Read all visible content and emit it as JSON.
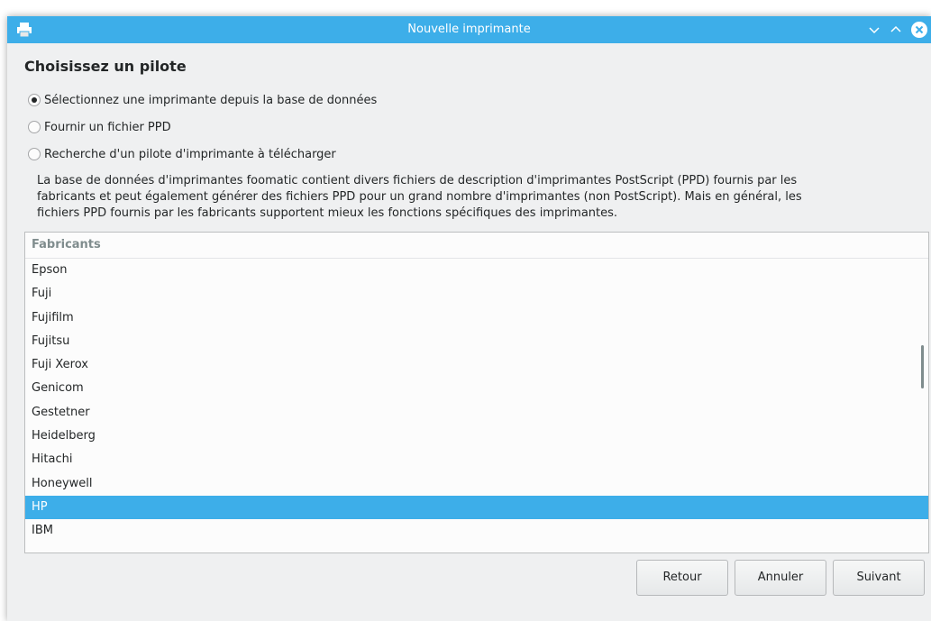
{
  "window": {
    "title": "Nouvelle imprimante"
  },
  "page": {
    "heading": "Choisissez un pilote"
  },
  "options": [
    {
      "label": "Sélectionnez une imprimante depuis la base de données",
      "checked": true
    },
    {
      "label": "Fournir un fichier PPD",
      "checked": false
    },
    {
      "label": "Recherche d'un pilote d'imprimante à télécharger",
      "checked": false
    }
  ],
  "description": [
    "La base de données d'imprimantes foomatic contient divers fichiers de description d'imprimantes PostScript (PPD) fournis par les",
    "fabricants et peut également générer des fichiers PPD pour un grand nombre d'imprimantes (non PostScript). Mais en général, les",
    "fichiers PPD fournis par les fabricants supportent mieux les fonctions spécifiques des imprimantes."
  ],
  "list": {
    "header": "Fabricants",
    "items": [
      "Epson",
      "Fuji",
      "Fujifilm",
      "Fujitsu",
      "Fuji Xerox",
      "Genicom",
      "Gestetner",
      "Heidelberg",
      "Hitachi",
      "Honeywell",
      "HP",
      "IBM"
    ],
    "selected": "HP"
  },
  "buttons": {
    "back": "Retour",
    "cancel": "Annuler",
    "next": "Suivant"
  },
  "colors": {
    "accent": "#3daee9",
    "window_bg": "#eff0f1",
    "list_bg": "#fcfcfc"
  },
  "icons": {
    "app": "printer-icon",
    "minimize": "chevron-down-icon",
    "maximize": "chevron-up-icon",
    "close": "close-icon"
  }
}
